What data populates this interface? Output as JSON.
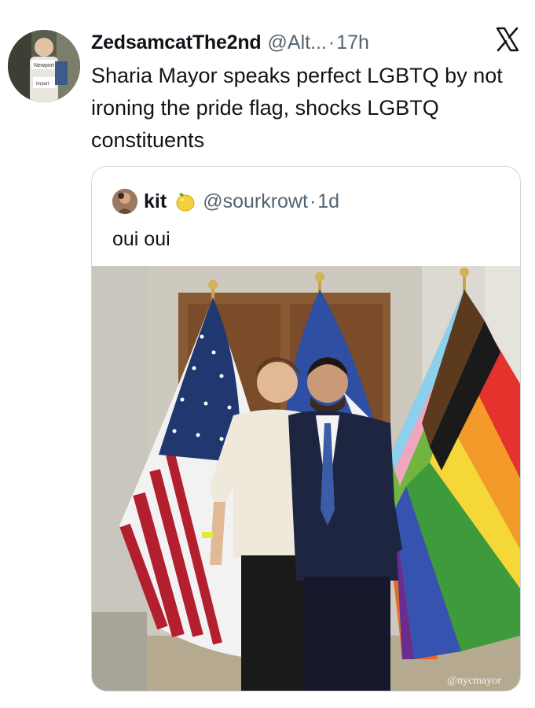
{
  "tweet": {
    "display_name": "ZedsamcatThe2nd",
    "handle": "@Alt...",
    "separator": "·",
    "time": "17h",
    "text": "Sharia Mayor speaks perfect LGBTQ by not ironing the pride flag, shocks LGBTQ constituents",
    "avatar_icon": "user-avatar-photo",
    "platform_icon": "x-logo-icon"
  },
  "quoted_tweet": {
    "display_name": "kit",
    "emoji_icon": "lemon-icon",
    "handle": "@sourkrowt",
    "separator": "·",
    "time": "1d",
    "text": "oui oui",
    "photo": {
      "description_icon": "photo-two-men-with-flags",
      "watermark": "@nycmayor"
    }
  },
  "colors": {
    "text_primary": "#0f1419",
    "text_secondary": "#536471",
    "border": "#cfd9de"
  }
}
